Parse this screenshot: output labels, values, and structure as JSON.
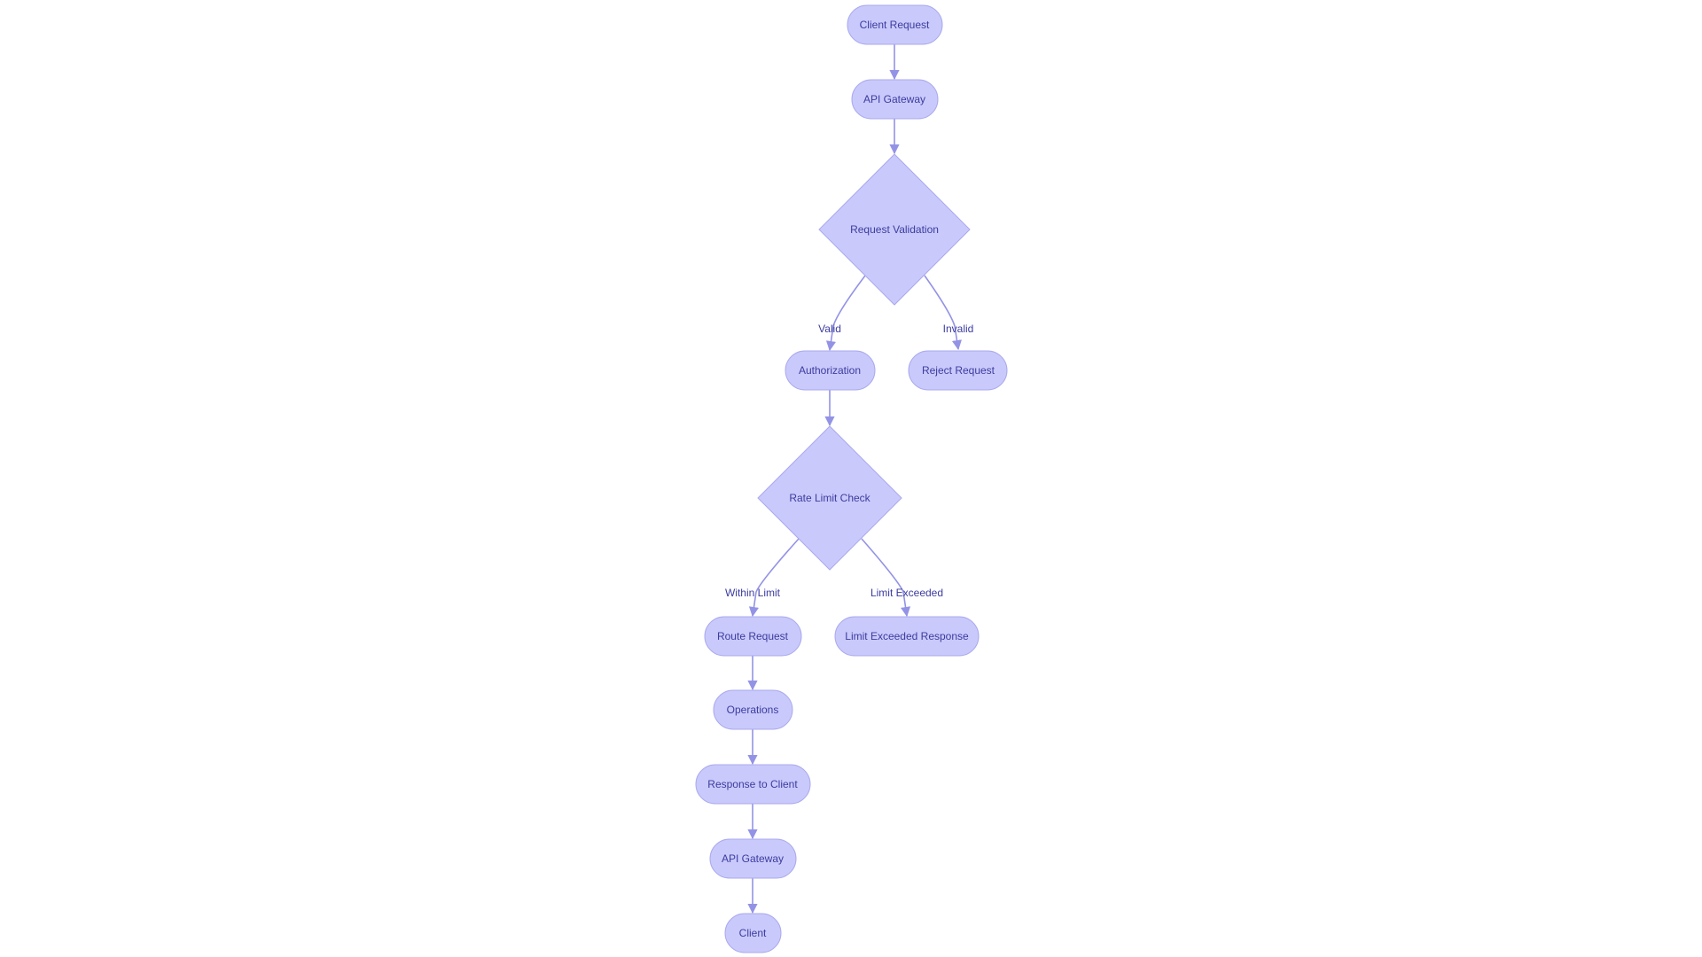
{
  "colors": {
    "node_fill": "#c9c9fb",
    "node_stroke": "#a9a9ef",
    "edge": "#9393e6",
    "text": "#3c3ca0"
  },
  "nodes": {
    "client_request": "Client Request",
    "api_gateway": "API Gateway",
    "request_validation": "Request Validation",
    "authorization": "Authorization",
    "reject_request": "Reject Request",
    "rate_limit_check": "Rate Limit Check",
    "route_request": "Route Request",
    "limit_exceeded_response": "Limit Exceeded Response",
    "operations": "Operations",
    "response_to_client": "Response to Client",
    "api_gateway_2": "API Gateway",
    "client": "Client"
  },
  "edge_labels": {
    "valid": "Valid",
    "invalid": "Invalid",
    "within_limit": "Within Limit",
    "limit_exceeded": "Limit Exceeded"
  }
}
